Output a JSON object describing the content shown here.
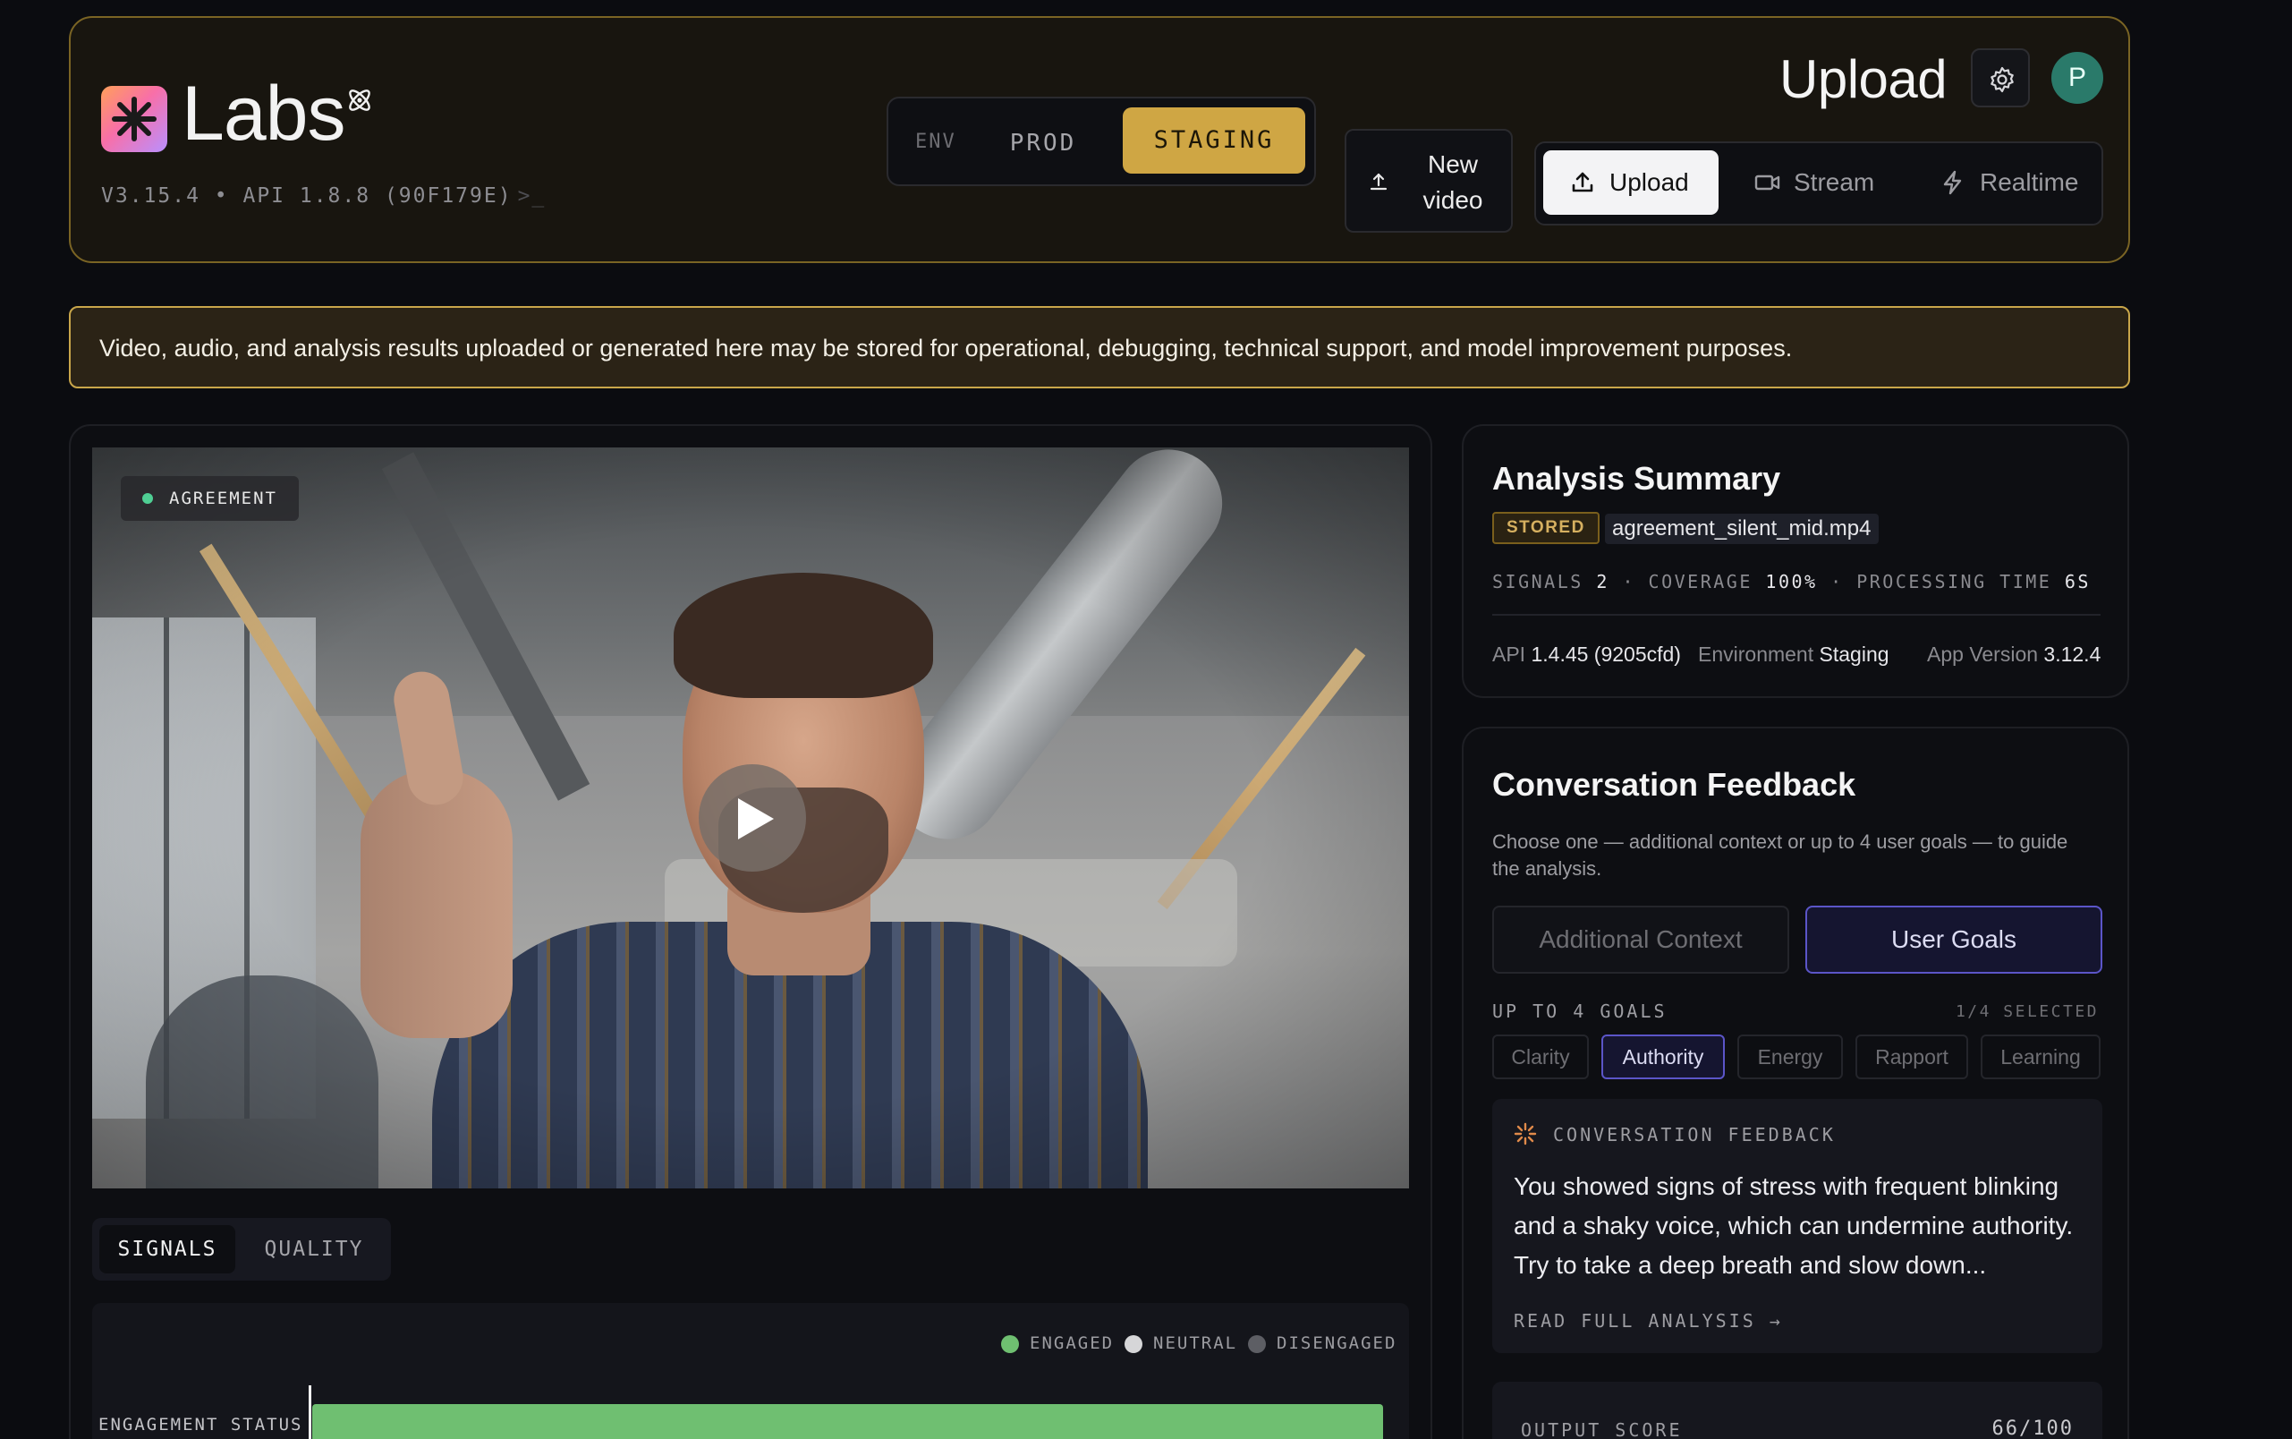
{
  "header": {
    "brand": "Labs",
    "version_line": "V3.15.4 • API 1.8.8 (90F179E)",
    "prompt_glyph": ">_",
    "env": {
      "label": "ENV",
      "prod": "PROD",
      "staging": "STAGING",
      "selected": "STAGING"
    },
    "new_video_label": "New video",
    "page_title": "Upload",
    "avatar_initial": "P",
    "modes": [
      {
        "label": "Upload",
        "icon": "upload-icon",
        "active": true
      },
      {
        "label": "Stream",
        "icon": "video-camera-icon",
        "active": false
      },
      {
        "label": "Realtime",
        "icon": "lightning-icon",
        "active": false
      }
    ]
  },
  "notice": {
    "text": "Video, audio, and analysis results uploaded or generated here may be stored for operational, debugging, technical support, and model improvement purposes."
  },
  "video": {
    "tag": "AGREEMENT",
    "play_icon": "play-icon"
  },
  "signals": {
    "tabs": [
      "SIGNALS",
      "QUALITY"
    ],
    "active_tab": "SIGNALS",
    "legend": [
      {
        "label": "ENGAGED",
        "color": "#6fbf71"
      },
      {
        "label": "NEUTRAL",
        "color": "#d6d6d8"
      },
      {
        "label": "DISENGAGED",
        "color": "#5d5e64"
      }
    ],
    "row_label": "ENGAGEMENT STATUS"
  },
  "summary": {
    "title": "Analysis Summary",
    "badge": "STORED",
    "filename": "agreement_silent_mid.mp4",
    "stats": {
      "signals_label": "SIGNALS",
      "signals_value": "2",
      "coverage_label": "COVERAGE",
      "coverage_value": "100%",
      "processing_label": "PROCESSING TIME",
      "processing_value": "6S"
    },
    "meta": {
      "api_label": "API",
      "api_value": "1.4.45 (9205cfd)",
      "env_label": "Environment",
      "env_value": "Staging",
      "app_label": "App Version",
      "app_value": "3.12.4"
    }
  },
  "feedback": {
    "title": "Conversation Feedback",
    "description": "Choose one — additional context or up to 4 user goals — to guide the analysis.",
    "options": {
      "context": "Additional Context",
      "goals": "User Goals",
      "selected": "User Goals"
    },
    "goals_header": "UP TO 4 GOALS",
    "goals_count": "1/4 SELECTED",
    "goals": [
      {
        "label": "Clarity",
        "active": false
      },
      {
        "label": "Authority",
        "active": true
      },
      {
        "label": "Energy",
        "active": false
      },
      {
        "label": "Rapport",
        "active": false
      },
      {
        "label": "Learning",
        "active": false
      }
    ],
    "card": {
      "heading": "CONVERSATION FEEDBACK",
      "text": "You showed signs of stress with frequent blinking and a shaky voice, which can undermine authority. Try to take a deep breath and slow down...",
      "link": "READ FULL ANALYSIS →"
    },
    "score": {
      "label": "OUTPUT SCORE",
      "value": "66/100"
    }
  }
}
